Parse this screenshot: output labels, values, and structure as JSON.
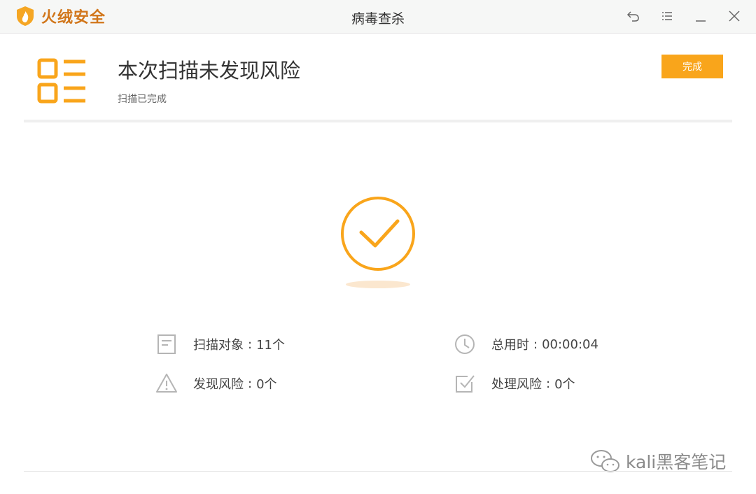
{
  "titlebar": {
    "brand_name": "火绒安全",
    "window_title": "病毒查杀",
    "icons": [
      "back-icon",
      "menu-icon",
      "minimize-icon",
      "close-icon"
    ]
  },
  "header": {
    "title": "本次扫描未发现风险",
    "subtitle": "扫描已完成",
    "done_button": "完成"
  },
  "stats": {
    "scan_objects": {
      "label": "扫描对象",
      "separator": ":",
      "value": "11个",
      "icon": "document-icon"
    },
    "total_time": {
      "label": "总用时",
      "separator": ":",
      "value": "00:00:04",
      "icon": "clock-icon"
    },
    "risks_found": {
      "label": "发现风险",
      "separator": ":",
      "value": "0个",
      "icon": "warning-icon"
    },
    "risks_handled": {
      "label": "处理风险",
      "separator": ":",
      "value": "0个",
      "icon": "checkbox-icon"
    }
  },
  "watermark": {
    "text": "kali黑客笔记"
  },
  "colors": {
    "accent": "#f9a51b",
    "brand": "#d1761a",
    "stat_icon": "#b5b5b5",
    "titlebar_bg": "#f6f7f6"
  }
}
